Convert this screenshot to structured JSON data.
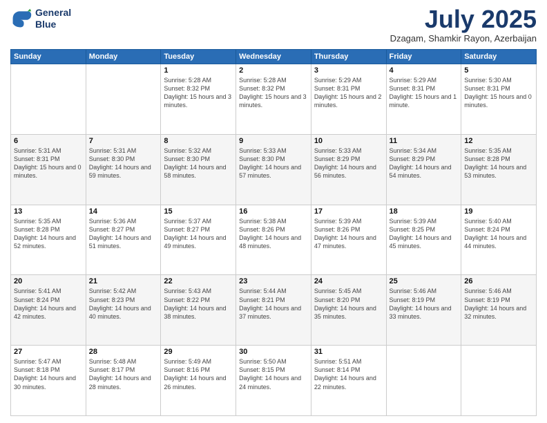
{
  "header": {
    "logo_line1": "General",
    "logo_line2": "Blue",
    "month_title": "July 2025",
    "location": "Dzagam, Shamkir Rayon, Azerbaijan"
  },
  "weekdays": [
    "Sunday",
    "Monday",
    "Tuesday",
    "Wednesday",
    "Thursday",
    "Friday",
    "Saturday"
  ],
  "weeks": [
    [
      {
        "day": "",
        "info": ""
      },
      {
        "day": "",
        "info": ""
      },
      {
        "day": "1",
        "info": "Sunrise: 5:28 AM\nSunset: 8:32 PM\nDaylight: 15 hours\nand 3 minutes."
      },
      {
        "day": "2",
        "info": "Sunrise: 5:28 AM\nSunset: 8:32 PM\nDaylight: 15 hours\nand 3 minutes."
      },
      {
        "day": "3",
        "info": "Sunrise: 5:29 AM\nSunset: 8:31 PM\nDaylight: 15 hours\nand 2 minutes."
      },
      {
        "day": "4",
        "info": "Sunrise: 5:29 AM\nSunset: 8:31 PM\nDaylight: 15 hours\nand 1 minute."
      },
      {
        "day": "5",
        "info": "Sunrise: 5:30 AM\nSunset: 8:31 PM\nDaylight: 15 hours\nand 0 minutes."
      }
    ],
    [
      {
        "day": "6",
        "info": "Sunrise: 5:31 AM\nSunset: 8:31 PM\nDaylight: 15 hours\nand 0 minutes."
      },
      {
        "day": "7",
        "info": "Sunrise: 5:31 AM\nSunset: 8:30 PM\nDaylight: 14 hours\nand 59 minutes."
      },
      {
        "day": "8",
        "info": "Sunrise: 5:32 AM\nSunset: 8:30 PM\nDaylight: 14 hours\nand 58 minutes."
      },
      {
        "day": "9",
        "info": "Sunrise: 5:33 AM\nSunset: 8:30 PM\nDaylight: 14 hours\nand 57 minutes."
      },
      {
        "day": "10",
        "info": "Sunrise: 5:33 AM\nSunset: 8:29 PM\nDaylight: 14 hours\nand 56 minutes."
      },
      {
        "day": "11",
        "info": "Sunrise: 5:34 AM\nSunset: 8:29 PM\nDaylight: 14 hours\nand 54 minutes."
      },
      {
        "day": "12",
        "info": "Sunrise: 5:35 AM\nSunset: 8:28 PM\nDaylight: 14 hours\nand 53 minutes."
      }
    ],
    [
      {
        "day": "13",
        "info": "Sunrise: 5:35 AM\nSunset: 8:28 PM\nDaylight: 14 hours\nand 52 minutes."
      },
      {
        "day": "14",
        "info": "Sunrise: 5:36 AM\nSunset: 8:27 PM\nDaylight: 14 hours\nand 51 minutes."
      },
      {
        "day": "15",
        "info": "Sunrise: 5:37 AM\nSunset: 8:27 PM\nDaylight: 14 hours\nand 49 minutes."
      },
      {
        "day": "16",
        "info": "Sunrise: 5:38 AM\nSunset: 8:26 PM\nDaylight: 14 hours\nand 48 minutes."
      },
      {
        "day": "17",
        "info": "Sunrise: 5:39 AM\nSunset: 8:26 PM\nDaylight: 14 hours\nand 47 minutes."
      },
      {
        "day": "18",
        "info": "Sunrise: 5:39 AM\nSunset: 8:25 PM\nDaylight: 14 hours\nand 45 minutes."
      },
      {
        "day": "19",
        "info": "Sunrise: 5:40 AM\nSunset: 8:24 PM\nDaylight: 14 hours\nand 44 minutes."
      }
    ],
    [
      {
        "day": "20",
        "info": "Sunrise: 5:41 AM\nSunset: 8:24 PM\nDaylight: 14 hours\nand 42 minutes."
      },
      {
        "day": "21",
        "info": "Sunrise: 5:42 AM\nSunset: 8:23 PM\nDaylight: 14 hours\nand 40 minutes."
      },
      {
        "day": "22",
        "info": "Sunrise: 5:43 AM\nSunset: 8:22 PM\nDaylight: 14 hours\nand 38 minutes."
      },
      {
        "day": "23",
        "info": "Sunrise: 5:44 AM\nSunset: 8:21 PM\nDaylight: 14 hours\nand 37 minutes."
      },
      {
        "day": "24",
        "info": "Sunrise: 5:45 AM\nSunset: 8:20 PM\nDaylight: 14 hours\nand 35 minutes."
      },
      {
        "day": "25",
        "info": "Sunrise: 5:46 AM\nSunset: 8:19 PM\nDaylight: 14 hours\nand 33 minutes."
      },
      {
        "day": "26",
        "info": "Sunrise: 5:46 AM\nSunset: 8:19 PM\nDaylight: 14 hours\nand 32 minutes."
      }
    ],
    [
      {
        "day": "27",
        "info": "Sunrise: 5:47 AM\nSunset: 8:18 PM\nDaylight: 14 hours\nand 30 minutes."
      },
      {
        "day": "28",
        "info": "Sunrise: 5:48 AM\nSunset: 8:17 PM\nDaylight: 14 hours\nand 28 minutes."
      },
      {
        "day": "29",
        "info": "Sunrise: 5:49 AM\nSunset: 8:16 PM\nDaylight: 14 hours\nand 26 minutes."
      },
      {
        "day": "30",
        "info": "Sunrise: 5:50 AM\nSunset: 8:15 PM\nDaylight: 14 hours\nand 24 minutes."
      },
      {
        "day": "31",
        "info": "Sunrise: 5:51 AM\nSunset: 8:14 PM\nDaylight: 14 hours\nand 22 minutes."
      },
      {
        "day": "",
        "info": ""
      },
      {
        "day": "",
        "info": ""
      }
    ]
  ]
}
